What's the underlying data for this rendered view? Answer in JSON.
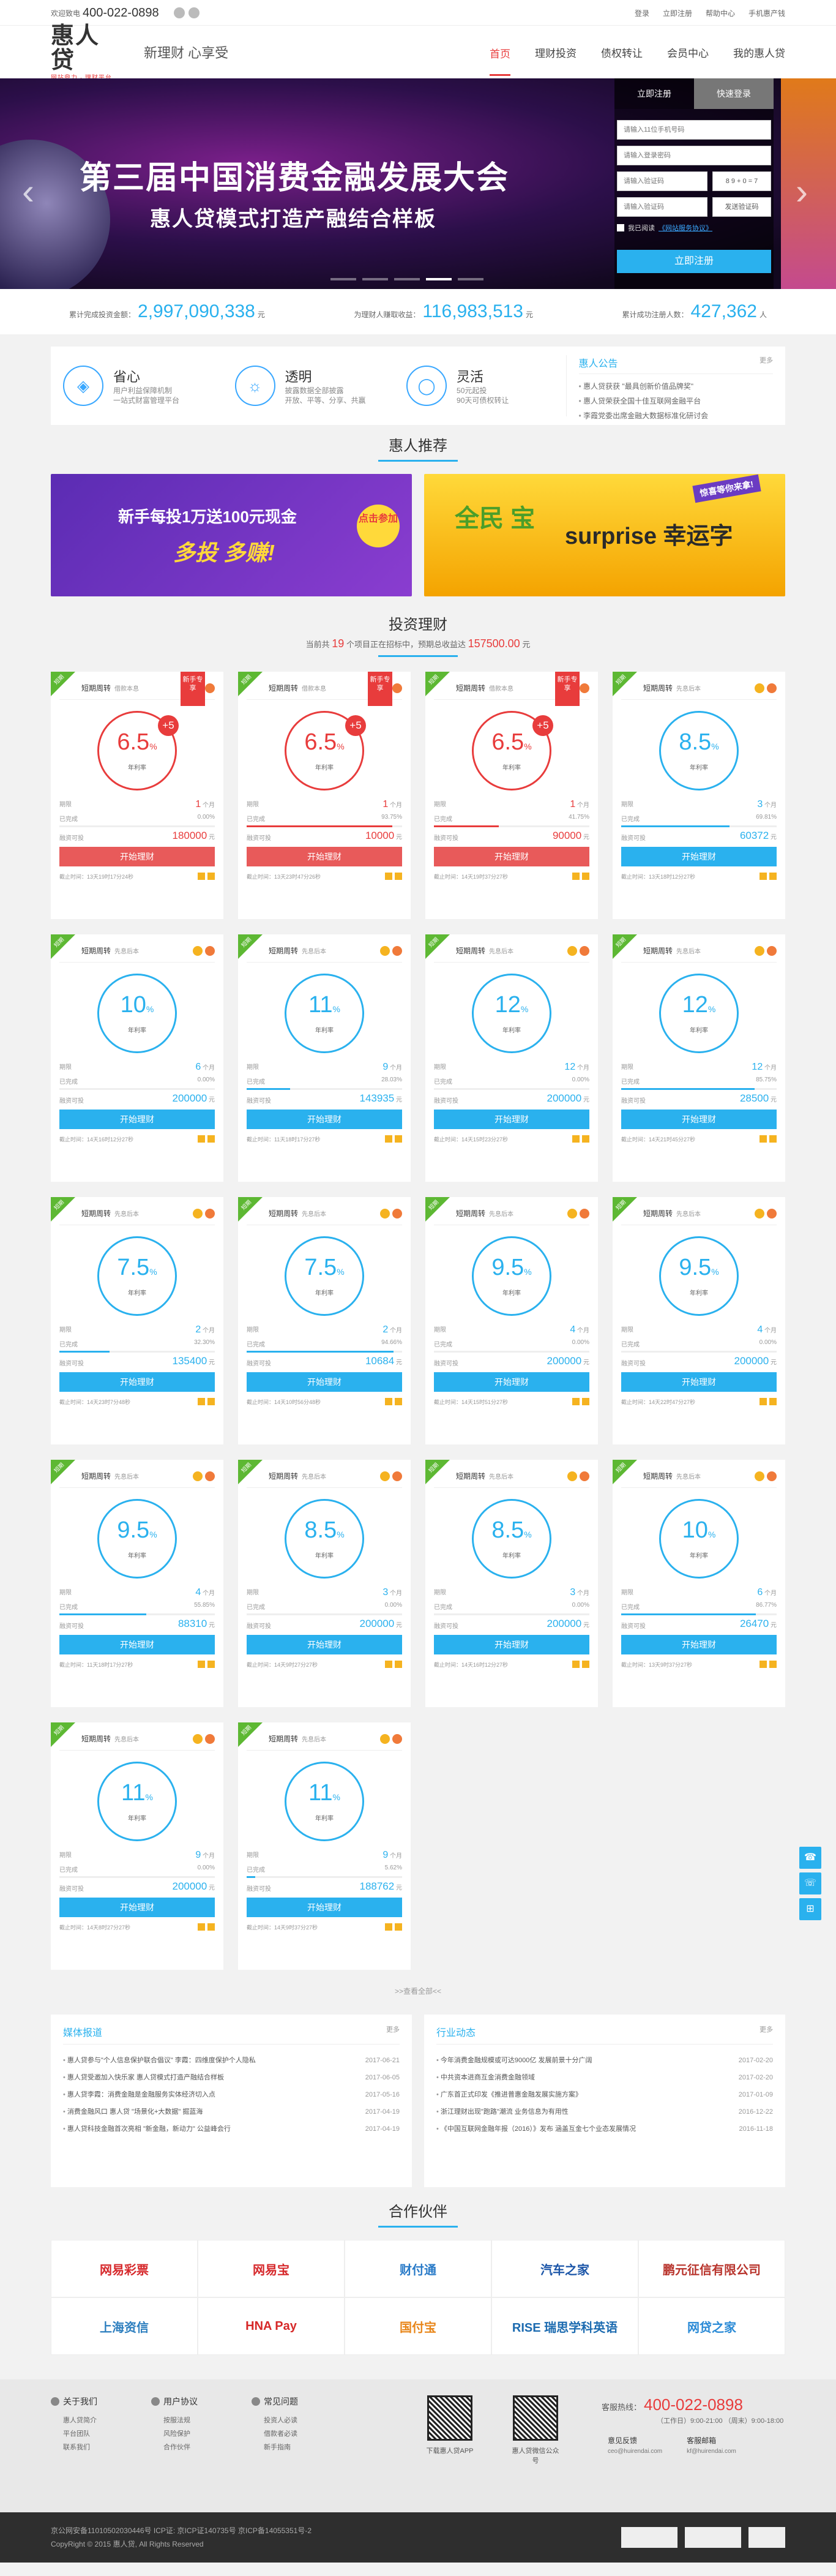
{
  "topbar": {
    "hotline_label": "欢迎致电",
    "hotline": "400-022-0898",
    "links": [
      "登录",
      "立即注册",
      "帮助中心",
      "手机惠产钱"
    ]
  },
  "header": {
    "logo": "惠人贷",
    "logo_sub": "网站鼎力 · 理财平台",
    "slogan": "新理财 心享受",
    "nav": [
      "首页",
      "理财投资",
      "债权转让",
      "会员中心",
      "我的惠人贷"
    ]
  },
  "banner": {
    "title": "第三届中国消费金融发展大会",
    "subtitle": "惠人贷模式打造产融结合样板",
    "login": {
      "tab_register": "立即注册",
      "tab_login": "快速登录",
      "phone_placeholder": "请输入11位手机号码",
      "password_placeholder": "请输入登录密码",
      "captcha_placeholder": "请输入验证码",
      "captcha_text": "8 9 + 0 = 7",
      "sms_placeholder": "请输入验证码",
      "sms_button": "发送验证码",
      "agree_text": "我已阅读",
      "agree_link": "《网站服务协议》",
      "submit": "立即注册"
    }
  },
  "stats": [
    {
      "label": "累计完成投资金额：",
      "value": "2,997,090,338",
      "unit": "元"
    },
    {
      "label": "为理财人赚取收益：",
      "value": "116,983,513",
      "unit": "元"
    },
    {
      "label": "累计成功注册人数：",
      "value": "427,362",
      "unit": "人"
    }
  ],
  "features": [
    {
      "icon": "shield-icon",
      "title": "省心",
      "desc1": "用户利益保障机制",
      "desc2": "一站式财富管理平台"
    },
    {
      "icon": "bulb-icon",
      "title": "透明",
      "desc1": "披露数据全部披露",
      "desc2": "开放、平等、分享、共赢"
    },
    {
      "icon": "piggy-icon",
      "title": "灵活",
      "desc1": "50元起投",
      "desc2": "90天可债权转让"
    }
  ],
  "notice": {
    "title": "惠人公告",
    "more": "更多",
    "items": [
      "惠人贷获获 \"最具创新价值品牌奖\"",
      "惠人贷荣获全国十佳互联网金融平台",
      "李霞党委出席金融大数据标准化研讨会"
    ]
  },
  "recommend_title": "惠人推荐",
  "promos": {
    "left_line1": "新手每投1万送100元现金",
    "left_line2": "多投 多赚!",
    "left_button": "点击参加",
    "right_line1": "全民 宝",
    "right_line2": "surprise 幸运字",
    "right_tag": "惊喜等你来拿!"
  },
  "invest": {
    "title": "投资理财",
    "sub_prefix": "当前共",
    "sub_count": "19",
    "sub_mid": "个项目正在招标中，预期总收益达",
    "sub_amount": "157500.00",
    "sub_unit": "元"
  },
  "products": [
    {
      "name": "短期周转",
      "type": "借款本息",
      "rate": "6.5",
      "plus": "+5",
      "new": "新手专享",
      "period": "1",
      "progress": "0.00%",
      "amount": "180000",
      "button": "开始理财",
      "style": "red",
      "deadline": "截止时间：13天19时17分24秒",
      "p": 0
    },
    {
      "name": "短期周转",
      "type": "借款本息",
      "rate": "6.5",
      "plus": "+5",
      "new": "新手专享",
      "period": "1",
      "progress": "93.75%",
      "amount": "10000",
      "button": "开始理财",
      "style": "red",
      "deadline": "截止时间：13天23时47分26秒",
      "p": 93.75
    },
    {
      "name": "短期周转",
      "type": "借款本息",
      "rate": "6.5",
      "plus": "+5",
      "new": "新手专享",
      "period": "1",
      "progress": "41.75%",
      "amount": "90000",
      "button": "开始理财",
      "style": "red",
      "deadline": "截止时间：14天19时37分27秒",
      "p": 41.75
    },
    {
      "name": "短期周转",
      "type": "先息后本",
      "rate": "8.5",
      "plus": "",
      "new": "",
      "period": "3",
      "progress": "69.81%",
      "amount": "60372",
      "button": "开始理财",
      "style": "blue",
      "deadline": "截止时间：13天18时12分27秒",
      "p": 69.81
    },
    {
      "name": "短期周转",
      "type": "先息后本",
      "rate": "10",
      "plus": "",
      "new": "",
      "period": "6",
      "progress": "0.00%",
      "amount": "200000",
      "button": "开始理财",
      "style": "blue",
      "deadline": "截止时间：14天16时12分27秒",
      "p": 0
    },
    {
      "name": "短期周转",
      "type": "先息后本",
      "rate": "11",
      "plus": "",
      "new": "",
      "period": "9",
      "progress": "28.03%",
      "amount": "143935",
      "button": "开始理财",
      "style": "blue",
      "deadline": "截止时间：11天18时17分27秒",
      "p": 28.03
    },
    {
      "name": "短期周转",
      "type": "先息后本",
      "rate": "12",
      "plus": "",
      "new": "",
      "period": "12",
      "progress": "0.00%",
      "amount": "200000",
      "button": "开始理财",
      "style": "blue",
      "deadline": "截止时间：14天15时23分27秒",
      "p": 0
    },
    {
      "name": "短期周转",
      "type": "先息后本",
      "rate": "12",
      "plus": "",
      "new": "",
      "period": "12",
      "progress": "85.75%",
      "amount": "28500",
      "button": "开始理财",
      "style": "blue",
      "deadline": "截止时间：14天21时45分27秒",
      "p": 85.75
    },
    {
      "name": "短期周转",
      "type": "先息后本",
      "rate": "7.5",
      "plus": "",
      "new": "",
      "period": "2",
      "progress": "32.30%",
      "amount": "135400",
      "button": "开始理财",
      "style": "blue",
      "deadline": "截止时间：14天23时7分48秒",
      "p": 32.3
    },
    {
      "name": "短期周转",
      "type": "先息后本",
      "rate": "7.5",
      "plus": "",
      "new": "",
      "period": "2",
      "progress": "94.66%",
      "amount": "10684",
      "button": "开始理财",
      "style": "blue",
      "deadline": "截止时间：14天10时56分48秒",
      "p": 94.66
    },
    {
      "name": "短期周转",
      "type": "先息后本",
      "rate": "9.5",
      "plus": "",
      "new": "",
      "period": "4",
      "progress": "0.00%",
      "amount": "200000",
      "button": "开始理财",
      "style": "blue",
      "deadline": "截止时间：14天15时51分27秒",
      "p": 0
    },
    {
      "name": "短期周转",
      "type": "先息后本",
      "rate": "9.5",
      "plus": "",
      "new": "",
      "period": "4",
      "progress": "0.00%",
      "amount": "200000",
      "button": "开始理财",
      "style": "blue",
      "deadline": "截止时间：14天22时47分27秒",
      "p": 0
    },
    {
      "name": "短期周转",
      "type": "先息后本",
      "rate": "9.5",
      "plus": "",
      "new": "",
      "period": "4",
      "progress": "55.85%",
      "amount": "88310",
      "button": "开始理财",
      "style": "blue",
      "deadline": "截止时间：11天18时17分27秒",
      "p": 55.85
    },
    {
      "name": "短期周转",
      "type": "先息后本",
      "rate": "8.5",
      "plus": "",
      "new": "",
      "period": "3",
      "progress": "0.00%",
      "amount": "200000",
      "button": "开始理财",
      "style": "blue",
      "deadline": "截止时间：14天9时27分27秒",
      "p": 0
    },
    {
      "name": "短期周转",
      "type": "先息后本",
      "rate": "8.5",
      "plus": "",
      "new": "",
      "period": "3",
      "progress": "0.00%",
      "amount": "200000",
      "button": "开始理财",
      "style": "blue",
      "deadline": "截止时间：14天16时12分27秒",
      "p": 0
    },
    {
      "name": "短期周转",
      "type": "先息后本",
      "rate": "10",
      "plus": "",
      "new": "",
      "period": "6",
      "progress": "86.77%",
      "amount": "26470",
      "button": "开始理财",
      "style": "blue",
      "deadline": "截止时间：13天9时37分27秒",
      "p": 86.77
    },
    {
      "name": "短期周转",
      "type": "先息后本",
      "rate": "11",
      "plus": "",
      "new": "",
      "period": "9",
      "progress": "0.00%",
      "amount": "200000",
      "button": "开始理财",
      "style": "blue",
      "deadline": "截止时间：14天8时27分27秒",
      "p": 0
    },
    {
      "name": "短期周转",
      "type": "先息后本",
      "rate": "11",
      "plus": "",
      "new": "",
      "period": "9",
      "progress": "5.62%",
      "amount": "188762",
      "button": "开始理财",
      "style": "blue",
      "deadline": "截止时间：14天9时37分27秒",
      "p": 5.62
    }
  ],
  "card_labels": {
    "period": "期限",
    "month": "个月",
    "progress": "已完成",
    "invest": "融资可投",
    "yuan": "元",
    "rate": "年利率",
    "corner": "短期"
  },
  "more_all": ">>查看全部<<",
  "news": [
    {
      "title": "媒体报道",
      "more": "更多",
      "items": [
        {
          "t": "惠人贷参与\"个人信息保护联合倡议\" 李霞：四维度保护个人隐私",
          "d": "2017-06-21"
        },
        {
          "t": "惠人贷受邀加入快乐家 惠人贷模式打造产融结合样板",
          "d": "2017-06-05"
        },
        {
          "t": "惠人贷李霞：消费金融是金融服务实体经济切入点",
          "d": "2017-05-16"
        },
        {
          "t": "消费金融风口 惠人贷 \"场景化+大数据\" 掘蓝海",
          "d": "2017-04-19"
        },
        {
          "t": "惠人贷科技金融首次亮相 \"新金融，新动力\" 公益峰会行",
          "d": "2017-04-19"
        }
      ]
    },
    {
      "title": "行业动态",
      "more": "更多",
      "items": [
        {
          "t": "今年消费金融规模或可达9000亿 发展前景十分广阔",
          "d": "2017-02-20"
        },
        {
          "t": "中共资本进商互金消费金融领域",
          "d": "2017-02-20"
        },
        {
          "t": "广东首正式印发《推进普惠金融发展实施方案》",
          "d": "2017-01-09"
        },
        {
          "t": "浙江理财出现\"跑路\"潮流 业务信息为有用性",
          "d": "2016-12-22"
        },
        {
          "t": "《中国互联网金融年报（2016）》发布 涵盖互金七个业态发展情况",
          "d": "2016-11-18"
        }
      ]
    }
  ],
  "partners_title": "合作伙伴",
  "partners": [
    {
      "name": "网易彩票",
      "color": "#d6282b"
    },
    {
      "name": "网易宝",
      "color": "#d6282b"
    },
    {
      "name": "财付通",
      "color": "#2a7bc8"
    },
    {
      "name": "汽车之家",
      "color": "#1c56a8"
    },
    {
      "name": "鹏元征信有限公司",
      "color": "#b8342c"
    },
    {
      "name": "上海资信",
      "color": "#2e7fbf"
    },
    {
      "name": "HNA Pay",
      "color": "#d62828"
    },
    {
      "name": "国付宝",
      "color": "#e8861a"
    },
    {
      "name": "RISE 瑞思学科英语",
      "color": "#1c6bb0"
    },
    {
      "name": "网贷之家",
      "color": "#2a8ad6"
    }
  ],
  "footer": {
    "cols": [
      {
        "title": "关于我们",
        "items": [
          "惠人贷简介",
          "平台团队",
          "联系我们"
        ]
      },
      {
        "title": "用户协议",
        "items": [
          "按服法规",
          "风险保护",
          "合作伙伴"
        ]
      },
      {
        "title": "常见问题",
        "items": [
          "投资人必读",
          "借款者必读",
          "新手指南"
        ]
      }
    ],
    "qr1": "下载惠人贷APP",
    "qr2": "惠人贷微信公众号",
    "hot_label": "客服热线：",
    "hot": "400-022-0898",
    "time": "（工作日）9:00-21:00  （周末）9:00-18:00",
    "feedback": "意见反馈",
    "feedback_mail": "ceo@huirendai.com",
    "mail_label": "客服邮箱",
    "mail": "kf@huirendai.com"
  },
  "bottombar": {
    "line1": "京公网安备11010502030446号  ICP证: 京ICP证140735号  京ICP备14055351号-2",
    "line2": "CopyRight © 2015 惠人贷, All Rights Reserved"
  }
}
